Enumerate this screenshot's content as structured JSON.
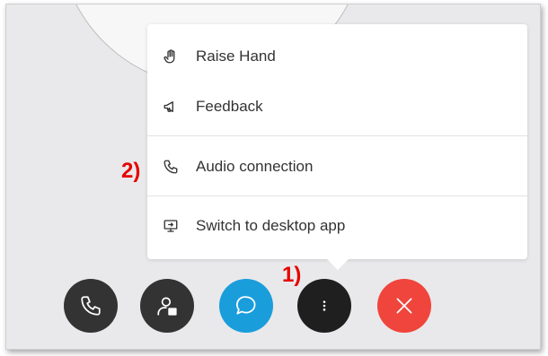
{
  "menu": {
    "items": [
      {
        "label": "Raise Hand",
        "icon": "hand-icon"
      },
      {
        "label": "Feedback",
        "icon": "megaphone-icon"
      },
      {
        "label": "Audio connection",
        "icon": "phone-icon"
      },
      {
        "label": "Switch to desktop app",
        "icon": "desktop-app-icon"
      }
    ]
  },
  "annotations": {
    "menu_button": "1)",
    "audio_item": "2)"
  },
  "controls": [
    {
      "name": "audio",
      "icon": "phone-icon",
      "color": "#333333"
    },
    {
      "name": "participants",
      "icon": "participants-icon",
      "color": "#333333"
    },
    {
      "name": "chat",
      "icon": "chat-icon",
      "color": "#1a9ddb"
    },
    {
      "name": "more",
      "icon": "more-vertical-icon",
      "color": "#1f1f1f"
    },
    {
      "name": "leave",
      "icon": "close-icon",
      "color": "#f0453c"
    }
  ]
}
